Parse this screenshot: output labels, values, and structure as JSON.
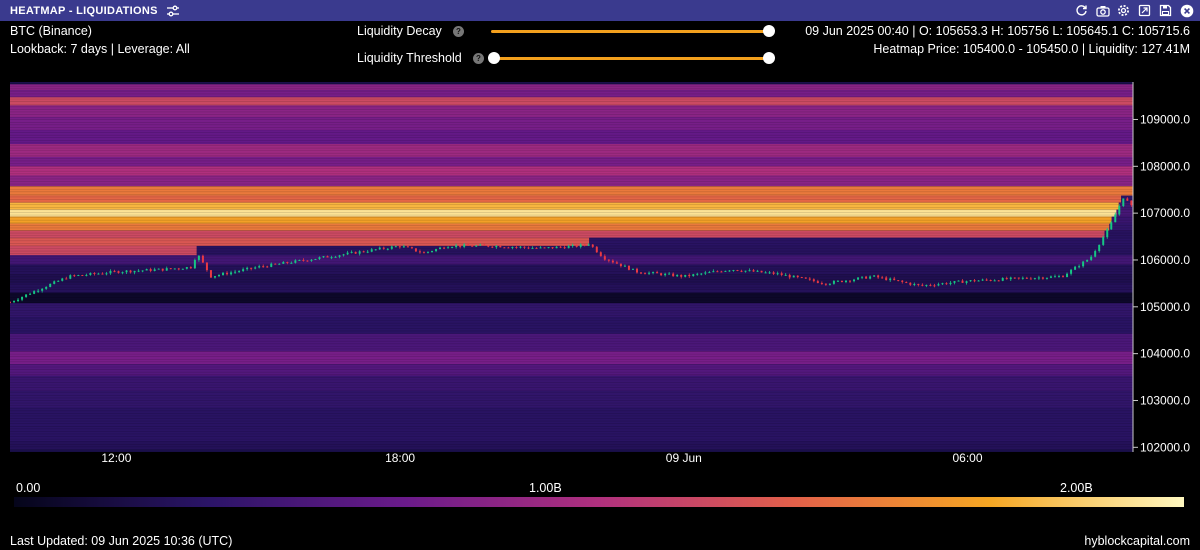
{
  "window": {
    "title": "HEATMAP - LIQUIDATIONS",
    "icons": [
      "refresh-icon",
      "camera-icon",
      "gear-icon",
      "export-icon",
      "save-icon",
      "close-icon"
    ]
  },
  "info": {
    "symbol": "BTC (Binance)",
    "lookback": "Lookback: 7 days | Leverage: All",
    "ohlc": "09 Jun 2025 00:40 | O: 105653.3 H: 105756 L: 105645.1 C: 105715.6",
    "heatmap_price": "Heatmap Price: 105400.0 - 105450.0 | Liquidity: 127.41M"
  },
  "controls": {
    "decay_label": "Liquidity Decay",
    "decay_value": 1.0,
    "threshold_label": "Liquidity Threshold",
    "threshold_min": 0.0,
    "threshold_max": 1.0
  },
  "colorbar": {
    "labels": [
      "0.00",
      "1.00B",
      "2.00B"
    ],
    "stops": [
      "#05051a",
      "#2b1467",
      "#6a1a8a",
      "#b0307e",
      "#e2604a",
      "#f5a623",
      "#fff8c0"
    ]
  },
  "footer": {
    "updated": "Last Updated: 09 Jun 2025 10:36 (UTC)",
    "brand": "hyblockcapital.com"
  },
  "colors": {
    "titlebar": "#3a3a8e",
    "slider": "#f3a01d",
    "up_candle": "#16c784",
    "down_candle": "#ea3943"
  },
  "chart_data": {
    "type": "heatmap",
    "title": "",
    "xlabel": "",
    "ylabel": "",
    "x_ticks": [
      "12:00",
      "18:00",
      "09 Jun",
      "06:00"
    ],
    "x_tick_hours": [
      12,
      18,
      24,
      30
    ],
    "x_range_hours": [
      9.75,
      33.5
    ],
    "y_ticks": [
      102000.0,
      103000.0,
      104000.0,
      105000.0,
      106000.0,
      107000.0,
      108000.0,
      109000.0
    ],
    "y_tick_labels": [
      "102000.0",
      "103000.0",
      "104000.0",
      "105000.0",
      "106000.0",
      "107000.0",
      "108000.0",
      "109000.0"
    ],
    "ylim": [
      101900,
      109800
    ],
    "color_range": [
      0,
      2.2
    ],
    "color_unit": "B",
    "price_series": [
      {
        "t": 9.75,
        "p": 105100
      },
      {
        "t": 10.3,
        "p": 105350
      },
      {
        "t": 11.0,
        "p": 105650
      },
      {
        "t": 12.0,
        "p": 105750
      },
      {
        "t": 13.0,
        "p": 105800
      },
      {
        "t": 13.6,
        "p": 105850
      },
      {
        "t": 13.7,
        "p": 106150
      },
      {
        "t": 14.0,
        "p": 105650
      },
      {
        "t": 15.0,
        "p": 105850
      },
      {
        "t": 16.0,
        "p": 106000
      },
      {
        "t": 17.0,
        "p": 106150
      },
      {
        "t": 18.0,
        "p": 106300
      },
      {
        "t": 18.5,
        "p": 106150
      },
      {
        "t": 19.0,
        "p": 106300
      },
      {
        "t": 20.0,
        "p": 106300
      },
      {
        "t": 21.0,
        "p": 106250
      },
      {
        "t": 21.8,
        "p": 106300
      },
      {
        "t": 22.0,
        "p": 106350
      },
      {
        "t": 22.3,
        "p": 106050
      },
      {
        "t": 23.0,
        "p": 105750
      },
      {
        "t": 24.0,
        "p": 105650
      },
      {
        "t": 25.0,
        "p": 105800
      },
      {
        "t": 26.0,
        "p": 105700
      },
      {
        "t": 26.5,
        "p": 105600
      },
      {
        "t": 27.0,
        "p": 105500
      },
      {
        "t": 28.0,
        "p": 105650
      },
      {
        "t": 29.0,
        "p": 105450
      },
      {
        "t": 30.0,
        "p": 105550
      },
      {
        "t": 31.0,
        "p": 105600
      },
      {
        "t": 32.0,
        "p": 105650
      },
      {
        "t": 32.6,
        "p": 106050
      },
      {
        "t": 33.0,
        "p": 106700
      },
      {
        "t": 33.3,
        "p": 107350
      },
      {
        "t": 33.5,
        "p": 107100
      }
    ],
    "liquidity_levels": [
      {
        "price": 109700,
        "value": 0.9
      },
      {
        "price": 109550,
        "value": 0.8
      },
      {
        "price": 109400,
        "value": 1.3
      },
      {
        "price": 109200,
        "value": 0.9
      },
      {
        "price": 108900,
        "value": 0.8
      },
      {
        "price": 108650,
        "value": 0.7
      },
      {
        "price": 108300,
        "value": 1.0
      },
      {
        "price": 108100,
        "value": 0.8
      },
      {
        "price": 107900,
        "value": 1.1
      },
      {
        "price": 107700,
        "value": 0.9
      },
      {
        "price": 107450,
        "value": 1.6
      },
      {
        "price": 107300,
        "value": 1.5
      },
      {
        "price": 107150,
        "value": 1.9
      },
      {
        "price": 107000,
        "value": 2.1
      },
      {
        "price": 106850,
        "value": 1.8
      },
      {
        "price": 106700,
        "value": 1.6
      },
      {
        "price": 106550,
        "value": 1.3
      },
      {
        "price": 106400,
        "value": 1.4
      },
      {
        "price": 106200,
        "value": 1.3
      },
      {
        "price": 106000,
        "value": 0.5
      },
      {
        "price": 105800,
        "value": 0.3
      },
      {
        "price": 105600,
        "value": 0.25
      },
      {
        "price": 105400,
        "value": 0.3
      },
      {
        "price": 105200,
        "value": 0.3
      },
      {
        "price": 104950,
        "value": 0.4
      },
      {
        "price": 104600,
        "value": 0.35
      },
      {
        "price": 104250,
        "value": 0.55
      },
      {
        "price": 103850,
        "value": 0.8
      },
      {
        "price": 103700,
        "value": 0.6
      },
      {
        "price": 103350,
        "value": 0.45
      },
      {
        "price": 103050,
        "value": 0.4
      },
      {
        "price": 102650,
        "value": 0.35
      },
      {
        "price": 102250,
        "value": 0.35
      },
      {
        "price": 102000,
        "value": 0.3
      }
    ]
  }
}
